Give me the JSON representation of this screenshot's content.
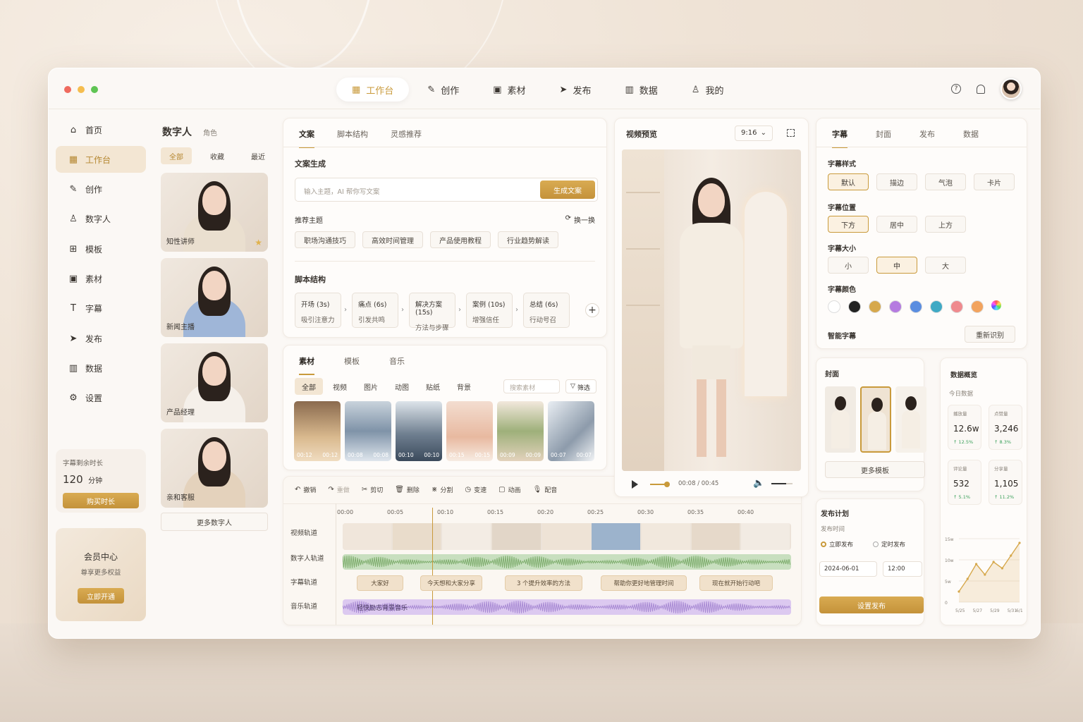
{
  "topnav": {
    "items": [
      {
        "label": "工作台",
        "icon": "workbench-icon",
        "active": true
      },
      {
        "label": "创作",
        "icon": "pen-icon"
      },
      {
        "label": "素材",
        "icon": "image-icon"
      },
      {
        "label": "发布",
        "icon": "send-icon"
      },
      {
        "label": "数据",
        "icon": "chart-icon"
      },
      {
        "label": "我的",
        "icon": "user-icon"
      }
    ],
    "help": "?"
  },
  "sidebar": {
    "items": [
      {
        "label": "首页",
        "icon": "home-icon"
      },
      {
        "label": "工作台",
        "icon": "workbench-icon",
        "active": true
      },
      {
        "label": "创作",
        "icon": "pen-icon"
      },
      {
        "label": "数字人",
        "icon": "user-icon"
      },
      {
        "label": "模板",
        "icon": "template-icon"
      },
      {
        "label": "素材",
        "icon": "image-icon"
      },
      {
        "label": "字幕",
        "icon": "subtitle-icon"
      },
      {
        "label": "发布",
        "icon": "send-icon"
      },
      {
        "label": "数据",
        "icon": "chart-icon"
      },
      {
        "label": "设置",
        "icon": "gear-icon"
      }
    ],
    "quota": {
      "label": "字幕剩余时长",
      "value": "120",
      "unit": "分钟",
      "button": "购买时长"
    },
    "vip": {
      "title": "会员中心",
      "subtitle": "尊享更多权益",
      "button": "立即开通"
    }
  },
  "digital": {
    "title": "数字人",
    "subtitle": "角色",
    "filters": [
      "全部",
      "收藏",
      "最近"
    ],
    "cards": [
      {
        "name": "知性讲师",
        "star": "★"
      },
      {
        "name": "新闻主播"
      },
      {
        "name": "产品经理"
      },
      {
        "name": "亲和客服"
      }
    ],
    "more": "更多数字人"
  },
  "copy": {
    "tabs": [
      "文案",
      "脚本结构",
      "灵感推荐"
    ],
    "gen_title": "文案生成",
    "input_placeholder": "输入主题，AI 帮你写文案",
    "gen_button": "生成文案",
    "rec_title": "推荐主题",
    "refresh": "换一换",
    "topics": [
      "职场沟通技巧",
      "高效时间管理",
      "产品使用教程",
      "行业趋势解读"
    ],
    "script_title": "脚本结构",
    "steps": [
      {
        "t": "开场 (3s)",
        "s": "吸引注意力"
      },
      {
        "t": "痛点 (6s)",
        "s": "引发共鸣"
      },
      {
        "t": "解决方案 (15s)",
        "s": "方法与步骤"
      },
      {
        "t": "案例 (10s)",
        "s": "增强信任"
      },
      {
        "t": "总结 (6s)",
        "s": "行动号召"
      }
    ],
    "add": "+"
  },
  "material": {
    "tabs": [
      "素材",
      "模板",
      "音乐"
    ],
    "filters": [
      "全部",
      "视频",
      "图片",
      "动图",
      "贴纸",
      "背景"
    ],
    "search_placeholder": "搜索素材",
    "filter_button": "筛选",
    "thumbs": [
      {
        "a": "00:12",
        "b": "00:12"
      },
      {
        "a": "00:08",
        "b": "00:08"
      },
      {
        "a": "00:10",
        "b": "00:10"
      },
      {
        "a": "00:15",
        "b": "00:15"
      },
      {
        "a": "00:09",
        "b": "00:09"
      },
      {
        "a": "00:07",
        "b": "00:07"
      }
    ]
  },
  "preview": {
    "title": "视频预览",
    "ratio": "9:16",
    "time": "00:08 / 00:45",
    "progress": 0.18,
    "volume": 0.7
  },
  "timeline": {
    "tools": [
      "撤销",
      "重做",
      "剪切",
      "删除",
      "分割",
      "变速",
      "动画",
      "配音"
    ],
    "ticks": [
      "00:00",
      "00:05",
      "00:10",
      "00:15",
      "00:20",
      "00:25",
      "00:30",
      "00:35",
      "00:40"
    ],
    "tracks": [
      "视频轨道",
      "数字人轨道",
      "字幕轨道",
      "音乐轨道"
    ],
    "subs": [
      "大家好",
      "今天想和大家分享",
      "3 个提升效率的方法",
      "帮助你更好地管理时间",
      "现在就开始行动吧"
    ],
    "music": "轻快励志背景音乐",
    "playhead": 0.2
  },
  "right": {
    "tabs": [
      "字幕",
      "封面",
      "发布",
      "数据"
    ],
    "style_title": "字幕样式",
    "styles": [
      "默认",
      "描边",
      "气泡",
      "卡片"
    ],
    "pos_title": "字幕位置",
    "positions": [
      "下方",
      "居中",
      "上方"
    ],
    "size_title": "字幕大小",
    "sizes": [
      "小",
      "中",
      "大"
    ],
    "color_title": "字幕颜色",
    "colors": [
      "#ffffff",
      "#222222",
      "#d6a84c",
      "#b57be0",
      "#5a8de0",
      "#3fa9c4",
      "#ef8a8e",
      "#f2a35e"
    ],
    "smart": "智能字幕",
    "redetect": "重新识别"
  },
  "cover": {
    "title": "封面",
    "more": "更多模板"
  },
  "publish": {
    "title": "发布计划",
    "time_label": "发布时间",
    "opt1": "立即发布",
    "opt2": "定时发布",
    "date": "2024-06-01",
    "clock": "12:00",
    "button": "设置发布"
  },
  "stats": {
    "title": "数据概览",
    "subtitle": "今日数据",
    "cards": [
      {
        "l": "播放量",
        "v": "12.6w",
        "d": "↑ 12.5%"
      },
      {
        "l": "点赞量",
        "v": "3,246",
        "d": "↑ 8.3%"
      },
      {
        "l": "评论量",
        "v": "532",
        "d": "↑ 5.1%"
      },
      {
        "l": "分享量",
        "v": "1,105",
        "d": "↑ 11.2%"
      }
    ]
  },
  "chart_data": {
    "type": "area",
    "x": [
      "5/25",
      "5/26",
      "5/27",
      "5/28",
      "5/29",
      "5/30",
      "5/31",
      "6/1"
    ],
    "xticks": [
      "5/25",
      "5/27",
      "5/29",
      "5/31",
      "6/1"
    ],
    "yticks": [
      "15w",
      "10w",
      "5w",
      "0"
    ],
    "values": [
      2.5,
      5.5,
      9,
      6.5,
      9.5,
      8,
      11,
      14
    ],
    "ylim": [
      0,
      15
    ],
    "color": "#d6a84c"
  }
}
